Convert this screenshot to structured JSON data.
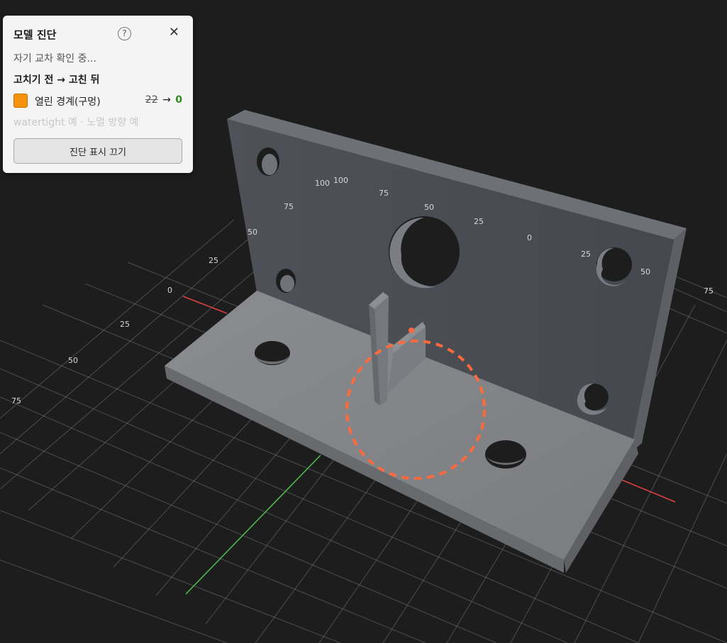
{
  "panel": {
    "title": "모델 진단",
    "help_icon": "question-circle-icon",
    "close_icon": "close-icon",
    "help_glyph": "?",
    "close_glyph": "✕",
    "status": "자기 교차 확인 중...",
    "compare_header": "고치기 전 → 고친 뒤",
    "issue": {
      "label": "열린 경계(구멍)",
      "before": "22",
      "arrow": "→",
      "after": "0",
      "color": "#f5930f"
    },
    "info": "watertight 예 · 노멀 방향 예",
    "toggle_button": "진단 표시 끄기"
  },
  "viewport": {
    "background": "#1d1d1d",
    "model_color": "#7f8184",
    "highlight_color": "#ff6a3d",
    "axis_x_color": "#e04040",
    "axis_y_color": "#4fc04f",
    "grid_labels": [
      "100",
      "100",
      "75",
      "75",
      "50",
      "50",
      "25",
      "25",
      "0",
      "0",
      "25",
      "25",
      "50",
      "50",
      "75",
      "75"
    ]
  }
}
